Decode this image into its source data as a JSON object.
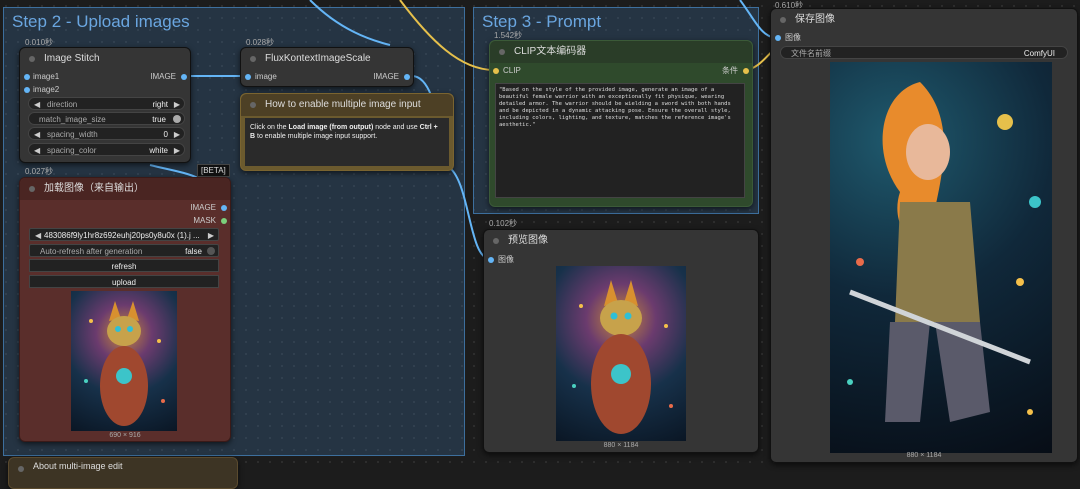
{
  "groups": {
    "step2": {
      "title": "Step 2 - Upload images"
    },
    "step3": {
      "title": "Step 3 - Prompt"
    }
  },
  "image_stitch": {
    "time": "0.010秒",
    "title": "Image Stitch",
    "inputs": [
      "image1",
      "image2"
    ],
    "output": "IMAGE",
    "widgets": [
      {
        "label": "direction",
        "value": "right"
      },
      {
        "label": "match_image_size",
        "value": "true"
      },
      {
        "label": "spacing_width",
        "value": "0"
      },
      {
        "label": "spacing_color",
        "value": "white"
      }
    ]
  },
  "flux_scale": {
    "time": "0.028秒",
    "title": "FluxKontextImageScale",
    "input": "image",
    "output": "IMAGE"
  },
  "note": {
    "title": "How to enable multiple image input",
    "text_pre": "Click on the ",
    "text_bold1": "Load image (from output)",
    "text_mid": " node and use ",
    "text_bold2": "Ctrl + B",
    "text_post": " to enable multiple image input support."
  },
  "load_image": {
    "badge": "[BETA]",
    "time": "0.027秒",
    "title": "加载图像（来自输出）",
    "outputs": [
      "IMAGE",
      "MASK"
    ],
    "file": "483086f9ly1hr8z692euhj20ps0y8u0x (1).j ...",
    "auto_refresh_label": "Auto-refresh after generation",
    "auto_refresh_value": "false",
    "refresh_button": "refresh",
    "upload_button": "upload",
    "image_caption": "690 × 916"
  },
  "clip": {
    "time": "1.542秒",
    "title": "CLIP文本编码器",
    "input": "CLIP",
    "output": "条件",
    "prompt": "\"Based on the style of the provided image, generate an image of a beautiful female warrior with an exceptionally fit physique, wearing detailed armor. The warrior should be wielding a sword with both hands and be depicted in a dynamic attacking pose. Ensure the overall style, including colors, lighting, and texture, matches the reference image's aesthetic.\""
  },
  "preview": {
    "time": "0.102秒",
    "title": "预览图像",
    "input": "图像",
    "image_caption": "880 × 1184"
  },
  "save": {
    "time": "0.610秒",
    "title": "保存图像",
    "input": "图像",
    "prefix_label": "文件名前缀",
    "prefix_value": "ComfyUI",
    "image_caption": "880 × 1184"
  },
  "bottom_node": {
    "title": "About multi-image edit"
  },
  "colors": {
    "group_border": "#3d6f9d",
    "group_title": "#6aa6e0",
    "load_node_bg": "#5a2e2b",
    "note_border": "#7a6430",
    "clip_border": "#3b5a38",
    "wire_blue": "#64b5f6",
    "wire_yellow": "#e6c04b"
  }
}
